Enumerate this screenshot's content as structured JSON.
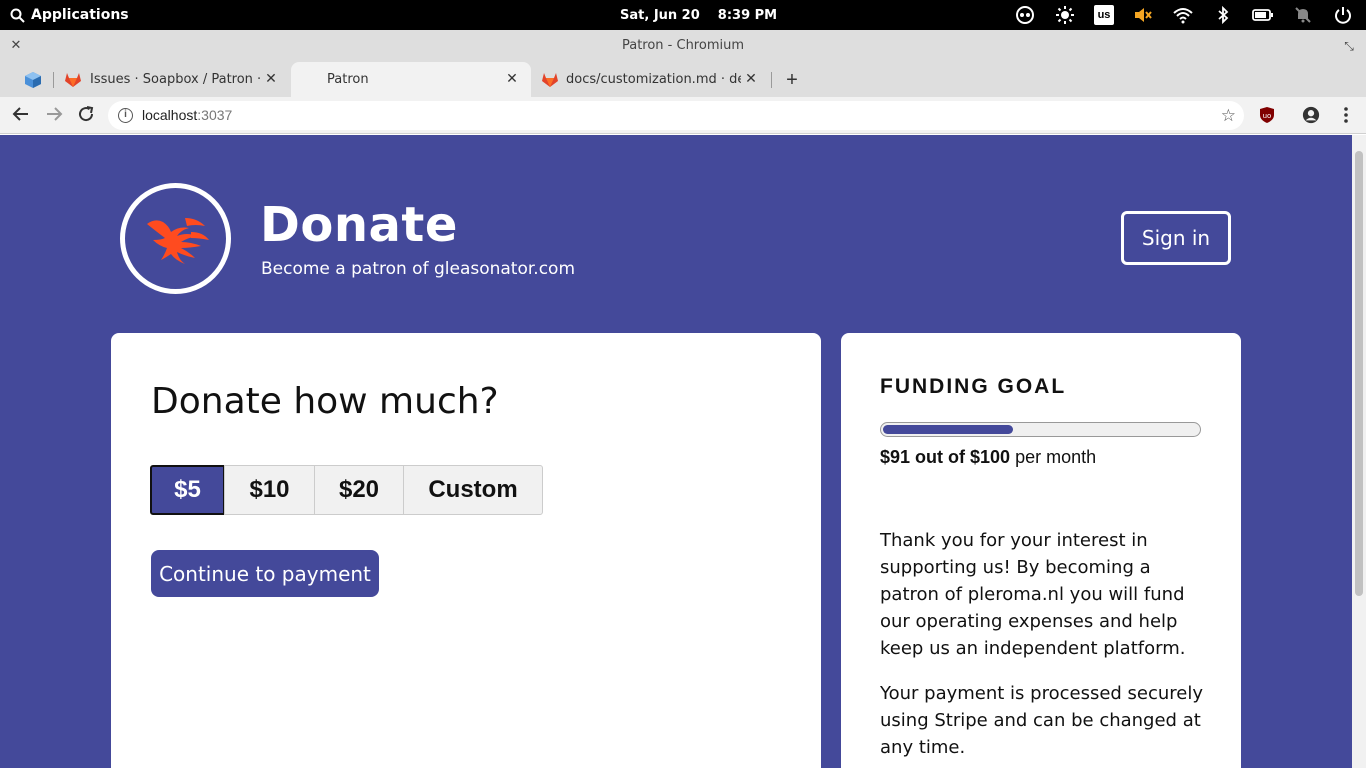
{
  "os_bar": {
    "applications_label": "Applications",
    "date": "Sat, Jun 20",
    "time": "8:39 PM",
    "keyboard_layout": "us",
    "tray_icons": [
      "network-icon",
      "night-light-icon",
      "keyboard-layout-icon",
      "volume-muted-icon",
      "wifi-icon",
      "bluetooth-icon",
      "battery-icon",
      "notifications-muted-icon",
      "power-icon"
    ]
  },
  "window": {
    "title": "Patron - Chromium"
  },
  "tabs": [
    {
      "title": "",
      "icon": "apps-icon"
    },
    {
      "title": "Issues · Soapbox / Patron · GitLab",
      "icon": "gitlab-icon"
    },
    {
      "title": "Patron",
      "icon": "",
      "active": true
    },
    {
      "title": "docs/customization.md · develop",
      "icon": "gitlab-icon"
    }
  ],
  "address_bar": {
    "host": "localhost",
    "port": ":3037"
  },
  "site": {
    "title": "Donate",
    "subtitle": "Become a patron of gleasonator.com",
    "signin_label": "Sign in"
  },
  "donate": {
    "heading": "Donate how much?",
    "amounts": [
      "$5",
      "$10",
      "$20",
      "Custom"
    ],
    "selected_amount": "$5",
    "continue_label": "Continue to payment"
  },
  "funding": {
    "heading": "FUNDING GOAL",
    "progress_fraction": 0.41,
    "amount_text": "$91 out of $100",
    "period_text": " per month",
    "paragraph1": "Thank you for your interest in supporting us! By becoming a patron of pleroma.nl you will fund our operating expenses and help keep us an independent platform.",
    "paragraph2": "Your payment is processed securely using Stripe and can be changed at any time."
  },
  "colors": {
    "brand": "#44499a",
    "logo_flame": "#ff4b1f"
  }
}
